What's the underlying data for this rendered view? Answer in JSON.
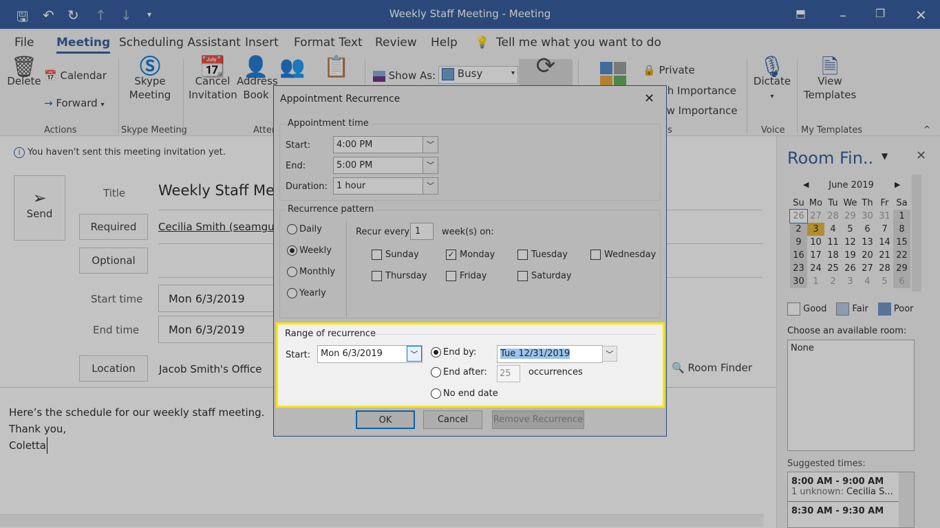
{
  "window": {
    "title": "Weekly Staff Meeting  -  Meeting"
  },
  "tabs": [
    "File",
    "Meeting",
    "Scheduling Assistant",
    "Insert",
    "Format Text",
    "Review",
    "Help"
  ],
  "tell_me": "Tell me what you want to do",
  "ribbon": {
    "delete": "Delete",
    "calendar": "Calendar",
    "forward": "Forward",
    "actions": "Actions",
    "skype": "Skype Meeting",
    "skype_group": "Skype Meeting",
    "cancel_inv": "Cancel Invitation",
    "address_book": "Address Book",
    "attendees_group": "Atten",
    "show_as": "Show As:",
    "busy": "Busy",
    "private": "Private",
    "high": "High Importance",
    "low": "Low Importance",
    "tags_group": "s",
    "dictate": "Dictate",
    "voice": "Voice",
    "view_templates": "View Templates",
    "my_templates": "My Templates"
  },
  "info": "You haven't sent this meeting invitation yet.",
  "form": {
    "send": "Send",
    "title_label": "Title",
    "title": "Weekly Staff Mee",
    "required": "Required",
    "required_value": "Cecilia Smith (seamguide",
    "optional": "Optional",
    "start_label": "Start time",
    "start_date": "Mon 6/3/2019",
    "end_label": "End time",
    "end_date": "Mon 6/3/2019",
    "location": "Location",
    "location_value": "Jacob Smith's Office",
    "room_finder": "Room Finder"
  },
  "body": [
    "Here’s the schedule for our weekly staff meeting.",
    "Thank you,",
    "Coletta"
  ],
  "pane": {
    "title": "Room Fin..",
    "month": "June 2019",
    "dow": [
      "Su",
      "Mo",
      "Tu",
      "We",
      "Th",
      "Fr",
      "Sa"
    ],
    "weeks": [
      [
        "26",
        "27",
        "28",
        "29",
        "30",
        "31",
        "1"
      ],
      [
        "2",
        "3",
        "4",
        "5",
        "6",
        "7",
        "8"
      ],
      [
        "9",
        "10",
        "11",
        "12",
        "13",
        "14",
        "15"
      ],
      [
        "16",
        "17",
        "18",
        "19",
        "20",
        "21",
        "22"
      ],
      [
        "23",
        "24",
        "25",
        "26",
        "27",
        "28",
        "29"
      ],
      [
        "30",
        "1",
        "2",
        "3",
        "4",
        "5",
        "6"
      ]
    ],
    "legend": [
      "Good",
      "Fair",
      "Poor"
    ],
    "choose": "Choose an available room:",
    "room": "None",
    "suggested": "Suggested times:",
    "slots": [
      {
        "time": "8:00 AM - 9:00 AM",
        "detail_label": "1 unknown:",
        "detail": "Cecilia S..."
      },
      {
        "time": "8:30 AM - 9:30 AM"
      }
    ]
  },
  "dialog": {
    "title": "Appointment Recurrence",
    "appt_time": "Appointment time",
    "start": "Start:",
    "start_val": "4:00 PM",
    "end": "End:",
    "end_val": "5:00 PM",
    "duration": "Duration:",
    "duration_val": "1 hour",
    "pattern": "Recurrence pattern",
    "patterns": [
      "Daily",
      "Weekly",
      "Monthly",
      "Yearly"
    ],
    "recur_every": "Recur every",
    "recur_n": "1",
    "weeks_on": "week(s) on:",
    "days": [
      {
        "l": "Sunday",
        "c": false
      },
      {
        "l": "Monday",
        "c": true
      },
      {
        "l": "Tuesday",
        "c": false
      },
      {
        "l": "Wednesday",
        "c": false
      },
      {
        "l": "Thursday",
        "c": false
      },
      {
        "l": "Friday",
        "c": false
      },
      {
        "l": "Saturday",
        "c": false
      }
    ],
    "range": "Range of recurrence",
    "range_start": "Start:",
    "range_start_val": "Mon 6/3/2019",
    "end_by": "End by:",
    "end_by_val": "Tue 12/31/2019",
    "end_after": "End after:",
    "occ_val": "25",
    "occurrences": "occurrences",
    "no_end": "No end date",
    "ok": "OK",
    "cancel": "Cancel",
    "remove": "Remove Recurrence"
  },
  "colors": {
    "accent": "#2b579a",
    "highlight": "#ffe600",
    "today": "#e8b82e"
  }
}
